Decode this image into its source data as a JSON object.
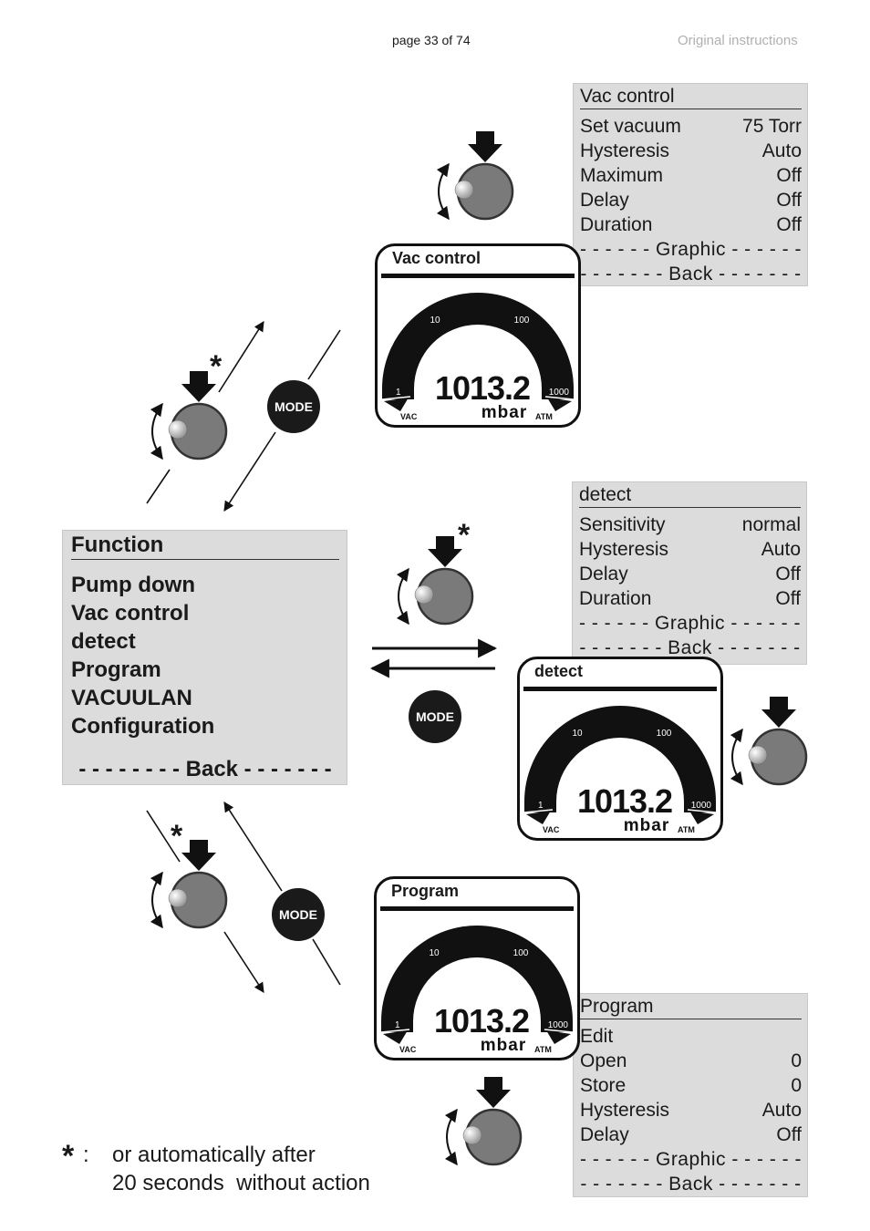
{
  "header": {
    "page": "page 33 of 74",
    "note": "Original instructions"
  },
  "vac_menu": {
    "title": "Vac control",
    "rows": [
      {
        "label": "Set vacuum",
        "value": "75 Torr"
      },
      {
        "label": "Hysteresis",
        "value": "Auto"
      },
      {
        "label": "Maximum",
        "value": "Off"
      },
      {
        "label": "Delay",
        "value": "Off"
      },
      {
        "label": "Duration",
        "value": "Off"
      }
    ],
    "graphic": "- - - - - - Graphic - - - - - -",
    "back": "- - - - - - - Back - - - - - - -"
  },
  "detect_menu": {
    "title": "detect",
    "rows": [
      {
        "label": "Sensitivity",
        "value": "normal"
      },
      {
        "label": "Hysteresis",
        "value": "Auto"
      },
      {
        "label": "Delay",
        "value": "Off"
      },
      {
        "label": "Duration",
        "value": "Off"
      }
    ],
    "graphic": "- - - - - - Graphic - - - - - -",
    "back": "- - - - - - - Back - - - - - - -"
  },
  "program_menu": {
    "title": "Program",
    "rows": [
      {
        "label": "Edit",
        "value": ""
      },
      {
        "label": "Open",
        "value": "0"
      },
      {
        "label": "Store",
        "value": "0"
      },
      {
        "label": "Hysteresis",
        "value": "Auto"
      },
      {
        "label": "Delay",
        "value": "Off"
      }
    ],
    "graphic": "- - - - - - Graphic - - - - - -",
    "back": "- - - - - - - Back - - - - - - -"
  },
  "function_menu": {
    "title": "Function",
    "items": [
      "Pump down",
      "Vac control",
      "detect",
      "Program",
      "VACUULAN",
      "Configuration"
    ],
    "back": "- - - - - - - - Back - - - - - - -"
  },
  "displays": [
    {
      "title": "Vac control",
      "value": "1013.2",
      "unit": "mbar",
      "ticks": [
        "1",
        "10",
        "100",
        "1000"
      ],
      "left_label": "VAC",
      "right_label": "ATM"
    },
    {
      "title": "detect",
      "value": "1013.2",
      "unit": "mbar",
      "ticks": [
        "1",
        "10",
        "100",
        "1000"
      ],
      "left_label": "VAC",
      "right_label": "ATM"
    },
    {
      "title": "Program",
      "value": "1013.2",
      "unit": "mbar",
      "ticks": [
        "1",
        "10",
        "100",
        "1000"
      ],
      "left_label": "VAC",
      "right_label": "ATM"
    }
  ],
  "mode_label": "MODE",
  "asterisk": "*",
  "footnote": {
    "marker": "*",
    "colon": ":",
    "line1": "or automatically after",
    "line2": "20 seconds  without action"
  },
  "colors": {
    "panel": "#dcdcdc",
    "knob": "#7a7a7a",
    "ink": "#111111"
  }
}
